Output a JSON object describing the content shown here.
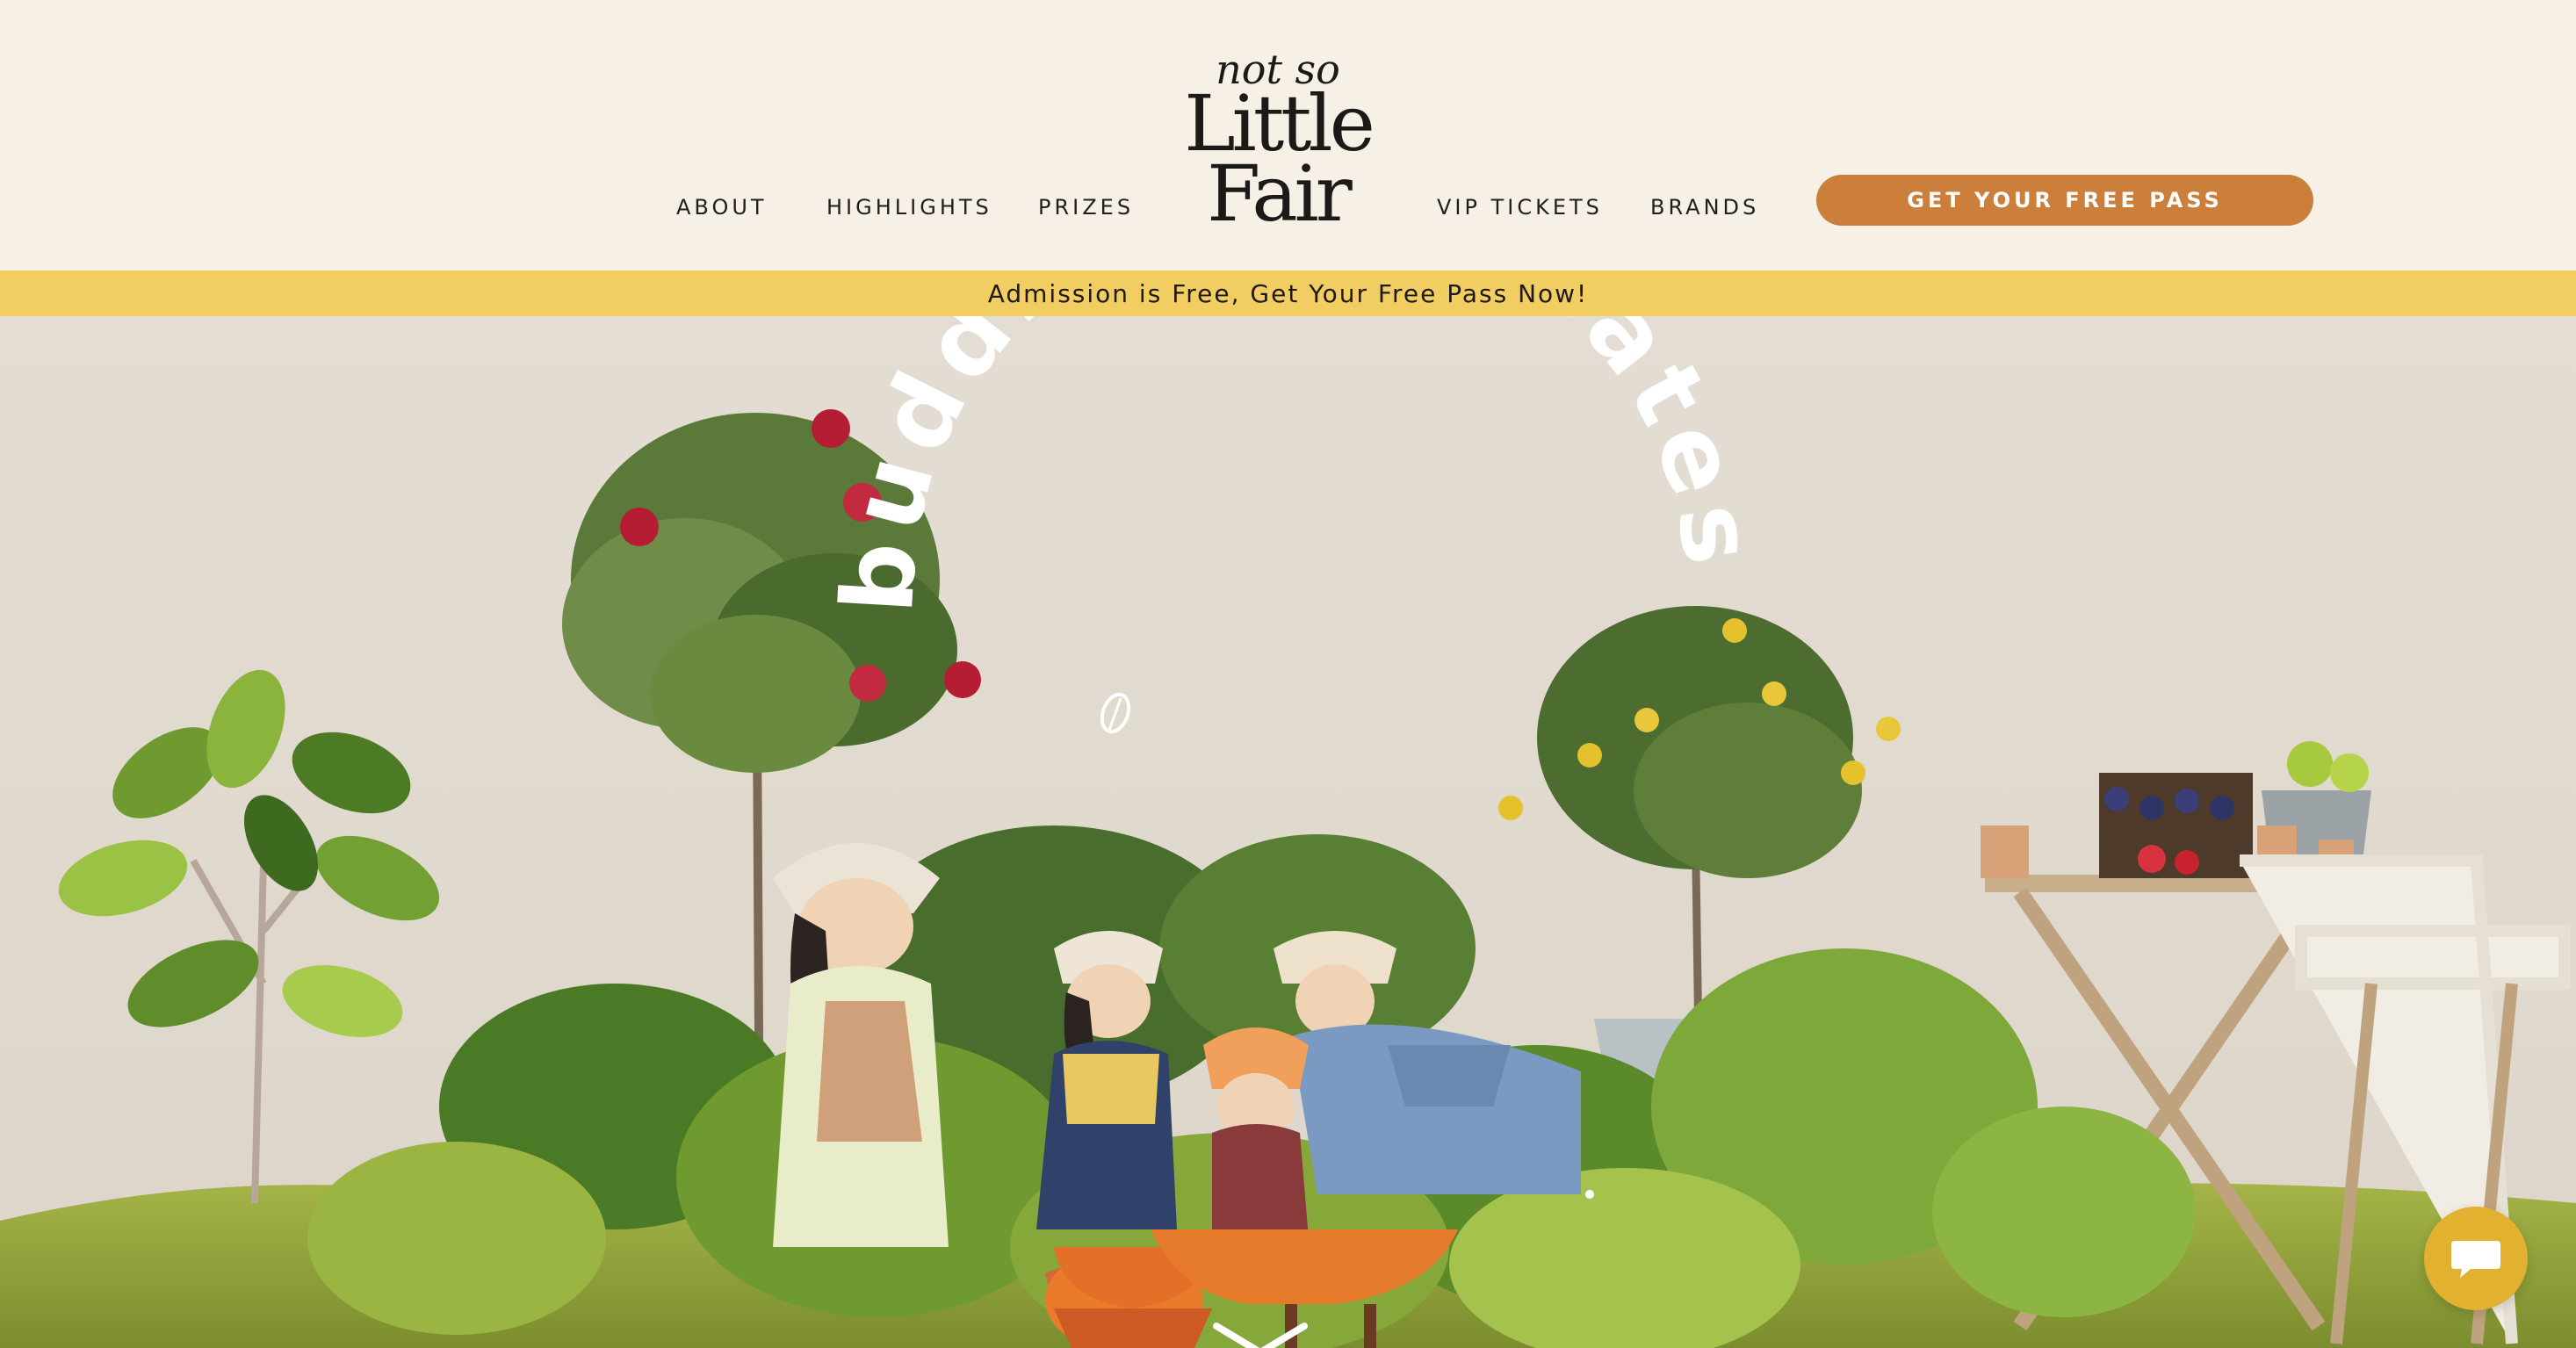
{
  "header": {
    "nav_left": [
      {
        "label": "ABOUT"
      },
      {
        "label": "HIGHLIGHTS"
      },
      {
        "label": "PRIZES"
      }
    ],
    "nav_right": [
      {
        "label": "VIP TICKETS"
      },
      {
        "label": "BRANDS"
      }
    ],
    "logo": {
      "line1": "not so",
      "line2": "Little",
      "line3": "Fair"
    },
    "cta_label": "GET YOUR FREE PASS"
  },
  "banner": {
    "text": "Admission is Free, Get Your Free Pass Now!"
  },
  "hero": {
    "headline": "budding playmates"
  },
  "colors": {
    "header_bg": "#f7f0e6",
    "banner_bg": "#f1cd62",
    "cta_bg": "#cc7f3b",
    "chat_bg": "#e1b12f"
  },
  "icons": {
    "chat": "chat-bubble-icon",
    "scroll": "chevron-down-icon",
    "leaf": "leaf-icon"
  }
}
